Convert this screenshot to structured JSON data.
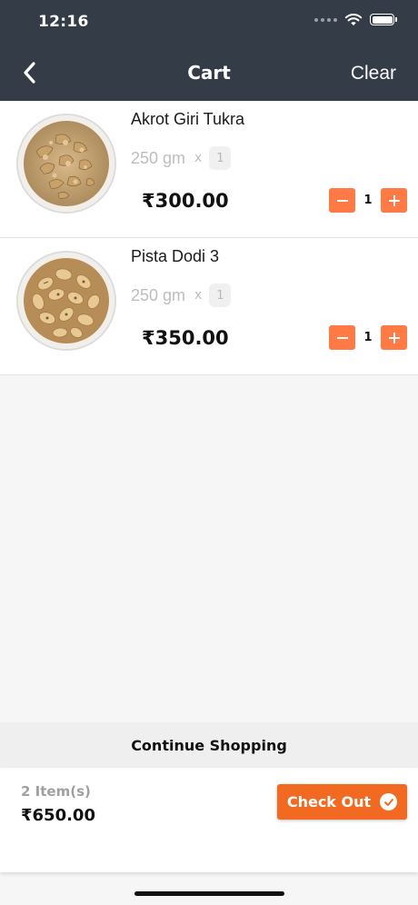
{
  "status": {
    "time": "12:16"
  },
  "header": {
    "title": "Cart",
    "clear_label": "Clear"
  },
  "items": [
    {
      "name": "Akrot Giri Tukra",
      "weight": "250 gm",
      "multiplier": "x",
      "badge_qty": "1",
      "price": "₹300.00",
      "quantity": "1",
      "image": "walnut-kernels-bowl"
    },
    {
      "name": "Pista Dodi 3",
      "weight": "250 gm",
      "multiplier": "x",
      "badge_qty": "1",
      "price": "₹350.00",
      "quantity": "1",
      "image": "pistachios-bowl"
    }
  ],
  "continue_label": "Continue Shopping",
  "footer": {
    "item_count": "2 Item(s)",
    "total": "₹650.00",
    "checkout_label": "Check Out"
  },
  "colors": {
    "header_bg": "#343c48",
    "accent": "#ff7a45",
    "checkout": "#f26a22"
  }
}
